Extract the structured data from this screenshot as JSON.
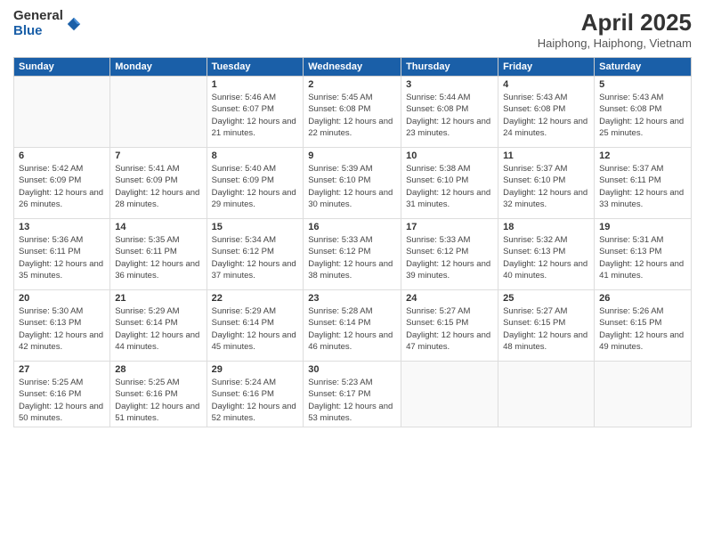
{
  "logo": {
    "general": "General",
    "blue": "Blue"
  },
  "title": "April 2025",
  "subtitle": "Haiphong, Haiphong, Vietnam",
  "days_header": [
    "Sunday",
    "Monday",
    "Tuesday",
    "Wednesday",
    "Thursday",
    "Friday",
    "Saturday"
  ],
  "weeks": [
    [
      {
        "day": "",
        "info": ""
      },
      {
        "day": "",
        "info": ""
      },
      {
        "day": "1",
        "info": "Sunrise: 5:46 AM\nSunset: 6:07 PM\nDaylight: 12 hours and 21 minutes."
      },
      {
        "day": "2",
        "info": "Sunrise: 5:45 AM\nSunset: 6:08 PM\nDaylight: 12 hours and 22 minutes."
      },
      {
        "day": "3",
        "info": "Sunrise: 5:44 AM\nSunset: 6:08 PM\nDaylight: 12 hours and 23 minutes."
      },
      {
        "day": "4",
        "info": "Sunrise: 5:43 AM\nSunset: 6:08 PM\nDaylight: 12 hours and 24 minutes."
      },
      {
        "day": "5",
        "info": "Sunrise: 5:43 AM\nSunset: 6:08 PM\nDaylight: 12 hours and 25 minutes."
      }
    ],
    [
      {
        "day": "6",
        "info": "Sunrise: 5:42 AM\nSunset: 6:09 PM\nDaylight: 12 hours and 26 minutes."
      },
      {
        "day": "7",
        "info": "Sunrise: 5:41 AM\nSunset: 6:09 PM\nDaylight: 12 hours and 28 minutes."
      },
      {
        "day": "8",
        "info": "Sunrise: 5:40 AM\nSunset: 6:09 PM\nDaylight: 12 hours and 29 minutes."
      },
      {
        "day": "9",
        "info": "Sunrise: 5:39 AM\nSunset: 6:10 PM\nDaylight: 12 hours and 30 minutes."
      },
      {
        "day": "10",
        "info": "Sunrise: 5:38 AM\nSunset: 6:10 PM\nDaylight: 12 hours and 31 minutes."
      },
      {
        "day": "11",
        "info": "Sunrise: 5:37 AM\nSunset: 6:10 PM\nDaylight: 12 hours and 32 minutes."
      },
      {
        "day": "12",
        "info": "Sunrise: 5:37 AM\nSunset: 6:11 PM\nDaylight: 12 hours and 33 minutes."
      }
    ],
    [
      {
        "day": "13",
        "info": "Sunrise: 5:36 AM\nSunset: 6:11 PM\nDaylight: 12 hours and 35 minutes."
      },
      {
        "day": "14",
        "info": "Sunrise: 5:35 AM\nSunset: 6:11 PM\nDaylight: 12 hours and 36 minutes."
      },
      {
        "day": "15",
        "info": "Sunrise: 5:34 AM\nSunset: 6:12 PM\nDaylight: 12 hours and 37 minutes."
      },
      {
        "day": "16",
        "info": "Sunrise: 5:33 AM\nSunset: 6:12 PM\nDaylight: 12 hours and 38 minutes."
      },
      {
        "day": "17",
        "info": "Sunrise: 5:33 AM\nSunset: 6:12 PM\nDaylight: 12 hours and 39 minutes."
      },
      {
        "day": "18",
        "info": "Sunrise: 5:32 AM\nSunset: 6:13 PM\nDaylight: 12 hours and 40 minutes."
      },
      {
        "day": "19",
        "info": "Sunrise: 5:31 AM\nSunset: 6:13 PM\nDaylight: 12 hours and 41 minutes."
      }
    ],
    [
      {
        "day": "20",
        "info": "Sunrise: 5:30 AM\nSunset: 6:13 PM\nDaylight: 12 hours and 42 minutes."
      },
      {
        "day": "21",
        "info": "Sunrise: 5:29 AM\nSunset: 6:14 PM\nDaylight: 12 hours and 44 minutes."
      },
      {
        "day": "22",
        "info": "Sunrise: 5:29 AM\nSunset: 6:14 PM\nDaylight: 12 hours and 45 minutes."
      },
      {
        "day": "23",
        "info": "Sunrise: 5:28 AM\nSunset: 6:14 PM\nDaylight: 12 hours and 46 minutes."
      },
      {
        "day": "24",
        "info": "Sunrise: 5:27 AM\nSunset: 6:15 PM\nDaylight: 12 hours and 47 minutes."
      },
      {
        "day": "25",
        "info": "Sunrise: 5:27 AM\nSunset: 6:15 PM\nDaylight: 12 hours and 48 minutes."
      },
      {
        "day": "26",
        "info": "Sunrise: 5:26 AM\nSunset: 6:15 PM\nDaylight: 12 hours and 49 minutes."
      }
    ],
    [
      {
        "day": "27",
        "info": "Sunrise: 5:25 AM\nSunset: 6:16 PM\nDaylight: 12 hours and 50 minutes."
      },
      {
        "day": "28",
        "info": "Sunrise: 5:25 AM\nSunset: 6:16 PM\nDaylight: 12 hours and 51 minutes."
      },
      {
        "day": "29",
        "info": "Sunrise: 5:24 AM\nSunset: 6:16 PM\nDaylight: 12 hours and 52 minutes."
      },
      {
        "day": "30",
        "info": "Sunrise: 5:23 AM\nSunset: 6:17 PM\nDaylight: 12 hours and 53 minutes."
      },
      {
        "day": "",
        "info": ""
      },
      {
        "day": "",
        "info": ""
      },
      {
        "day": "",
        "info": ""
      }
    ]
  ]
}
